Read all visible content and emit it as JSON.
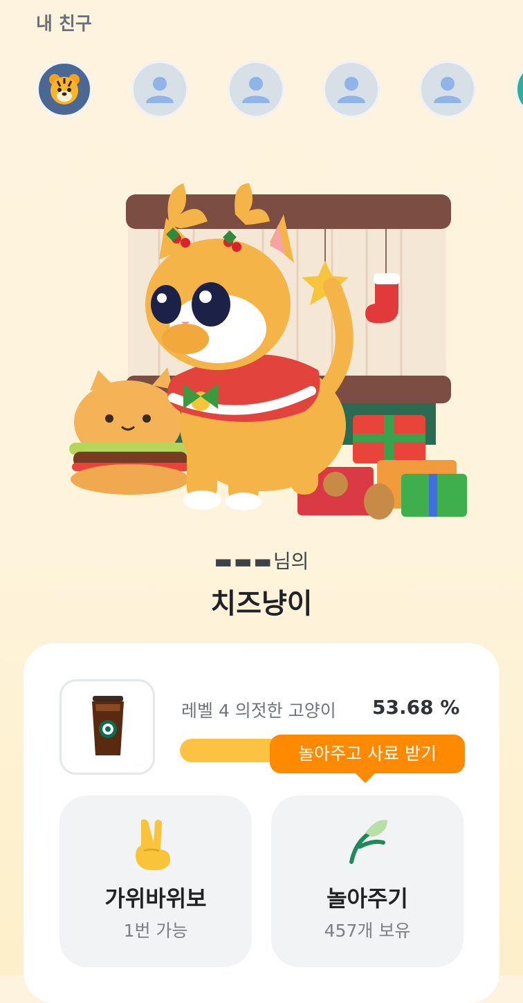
{
  "header": {
    "title": "내 친구"
  },
  "friends": [
    {
      "name": "",
      "avatar": "tiger-icon"
    },
    {
      "name": "",
      "avatar": "person-icon"
    },
    {
      "name": "",
      "avatar": "person-icon"
    },
    {
      "name": "",
      "avatar": "person-icon"
    },
    {
      "name": "",
      "avatar": "person-icon"
    }
  ],
  "pet": {
    "owner_suffix": "님의",
    "name": "치즈냥이"
  },
  "status": {
    "level_label": "레벨 4 의젓한 고양이",
    "percent_text": "53.68 %",
    "progress": 0.5368,
    "tooltip": "놀아주고 사료 받기",
    "item_icon": "iced-coffee-icon"
  },
  "actions": [
    {
      "title": "가위바위보",
      "subtitle": "1번 가능",
      "icon": "victory-hand-icon"
    },
    {
      "title": "놀아주기",
      "subtitle": "457개 보유",
      "icon": "leaf-toy-icon"
    }
  ],
  "colors": {
    "accent": "#ff8a00",
    "progress_fill": "#fbc341",
    "background": "#fef4dc"
  }
}
